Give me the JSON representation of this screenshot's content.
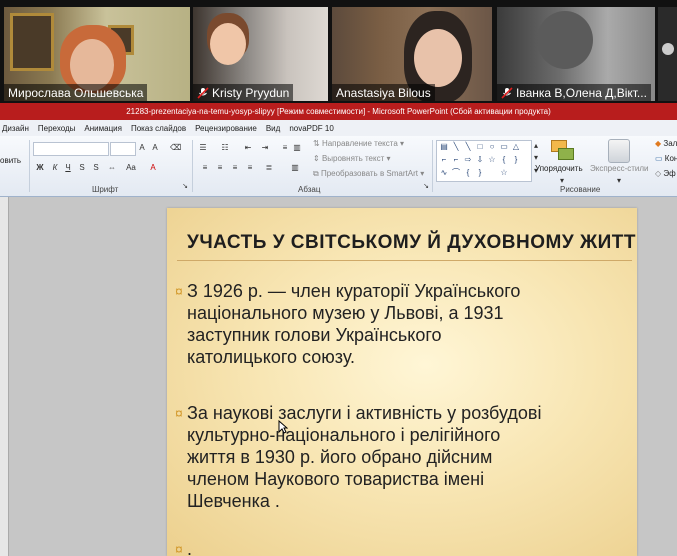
{
  "participants": [
    {
      "name": "Мирослава Ольшевська",
      "muted": false
    },
    {
      "name": "Kristy Pryydun",
      "muted": true
    },
    {
      "name": "Anastasiya Bilous",
      "muted": false
    },
    {
      "name": "Іванка В,Олена Д,Вікт...",
      "muted": true
    }
  ],
  "window": {
    "title": "21283-prezentaciya-na-temu-yosyp-slipyy [Режим совместимости] - Microsoft PowerPoint (Сбой активации продукта)"
  },
  "ribbon": {
    "tabs": [
      "Дизайн",
      "Переходы",
      "Анимация",
      "Показ слайдов",
      "Рецензирование",
      "Вид",
      "novaPDF 10"
    ],
    "clipboard_partial": "овить",
    "groups": {
      "font": "Шрифт",
      "paragraph": "Абзац",
      "drawing": "Рисование"
    },
    "paragraph_commands": {
      "text_direction": "Направление текста",
      "align_text": "Выровнять текст",
      "smartart": "Преобразовать в SmartArt"
    },
    "drawing_commands": {
      "arrange": "Упорядочить",
      "quick_styles": "Экспресс-стили"
    },
    "right_partial": [
      "Зал",
      "Кон",
      "Эф"
    ]
  },
  "slide": {
    "title": "УЧАСТЬ У СВІТСЬКОМУ Й ДУХОВНОМУ ЖИТТІ",
    "bullet_glyph": "¤",
    "bullets": [
      {
        "lines": [
          "З 1926 р. — член кураторії Українського",
          "національного музею у Львові, а 1931",
          "заступник голови Українського",
          "католицького союзу."
        ]
      },
      {
        "lines": [
          "За наукові заслуги і активність у розбудові",
          "культурно-національного і релігійного",
          "життя в 1930 р. його обрано дійсним",
          "членом Наукового товариства імені",
          "Шевченка ."
        ]
      }
    ],
    "third_bullet": "."
  }
}
